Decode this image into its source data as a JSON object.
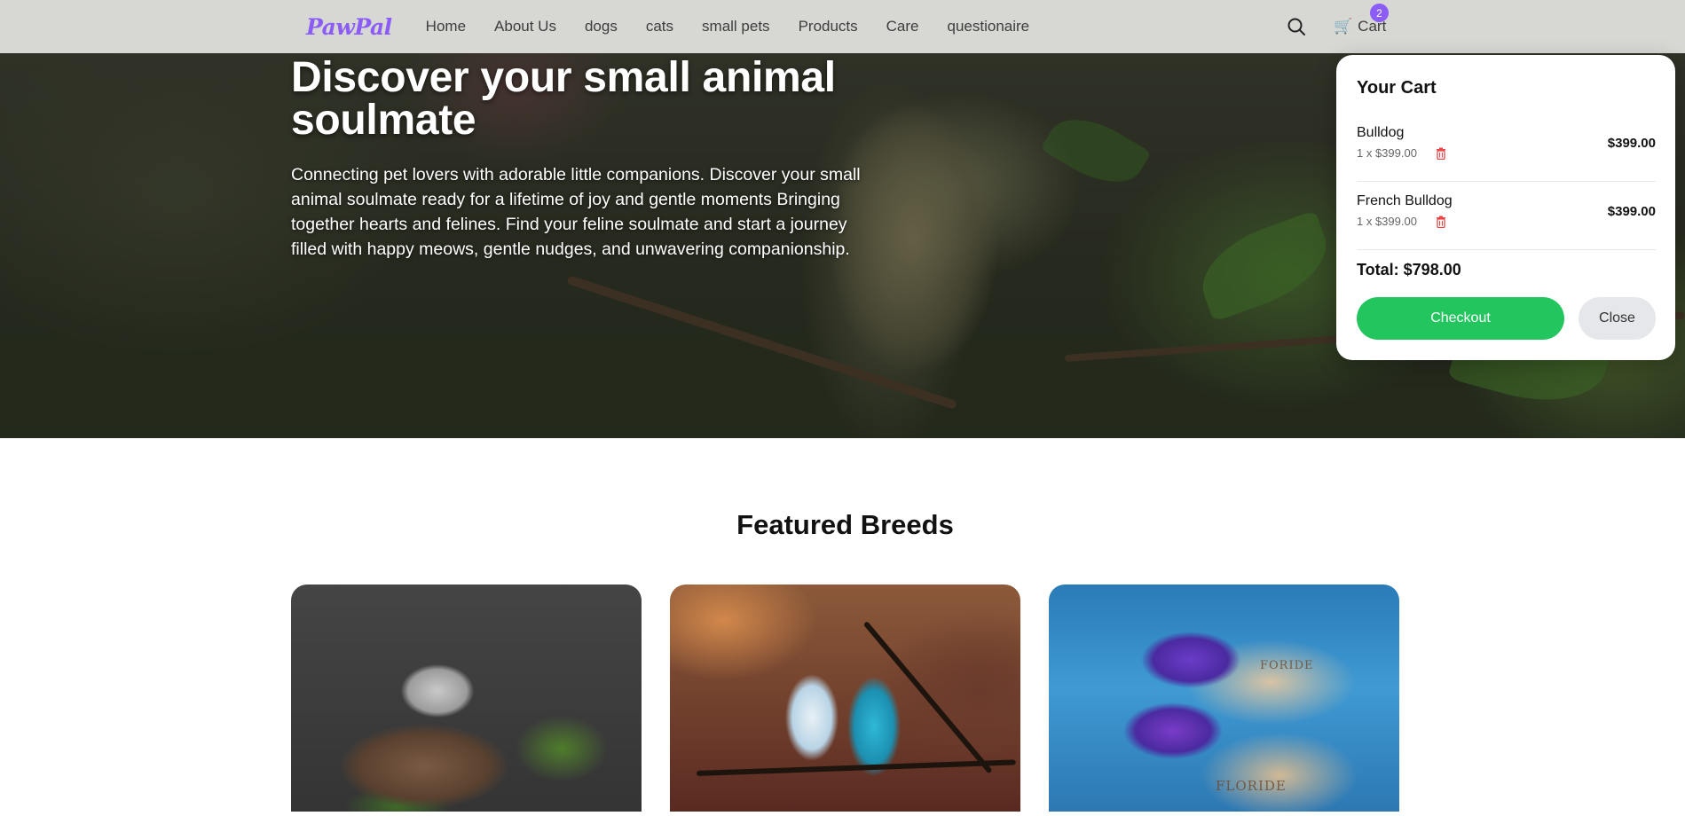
{
  "nav": {
    "logo": "PawPal",
    "links": [
      "Home",
      "About Us",
      "dogs",
      "cats",
      "small pets",
      "Products",
      "Care",
      "questionaire"
    ],
    "search_icon": "search-icon",
    "cart_label": "Cart",
    "cart_icon": "shopping-cart-icon",
    "cart_count": "2"
  },
  "hero": {
    "title": "Discover your small animal soulmate",
    "description": "Connecting pet lovers with adorable little companions. Discover your small animal soulmate ready for a lifetime of joy and gentle moments Bringing together hearts and felines. Find your feline soulmate and start a journey filled with happy meows, gentle nudges, and unwavering companionship."
  },
  "featured": {
    "title": "Featured Breeds",
    "cards": [
      {
        "image": "hamster-photo"
      },
      {
        "image": "budgies-photo"
      },
      {
        "image": "betta-fish-photo",
        "map_labels": [
          "FORIDE",
          "FLORIDE"
        ]
      }
    ]
  },
  "cart": {
    "title": "Your Cart",
    "items": [
      {
        "name": "Bulldog",
        "qty_line": "1 x $399.00",
        "price": "$399.00"
      },
      {
        "name": "French Bulldog",
        "qty_line": "1 x $399.00",
        "price": "$399.00"
      }
    ],
    "total": "Total: $798.00",
    "checkout_label": "Checkout",
    "close_label": "Close"
  },
  "colors": {
    "brand": "#8b5cf6",
    "checkout": "#22c55e",
    "nav_bg": "#d7d8d3",
    "trash": "#ef4444"
  }
}
